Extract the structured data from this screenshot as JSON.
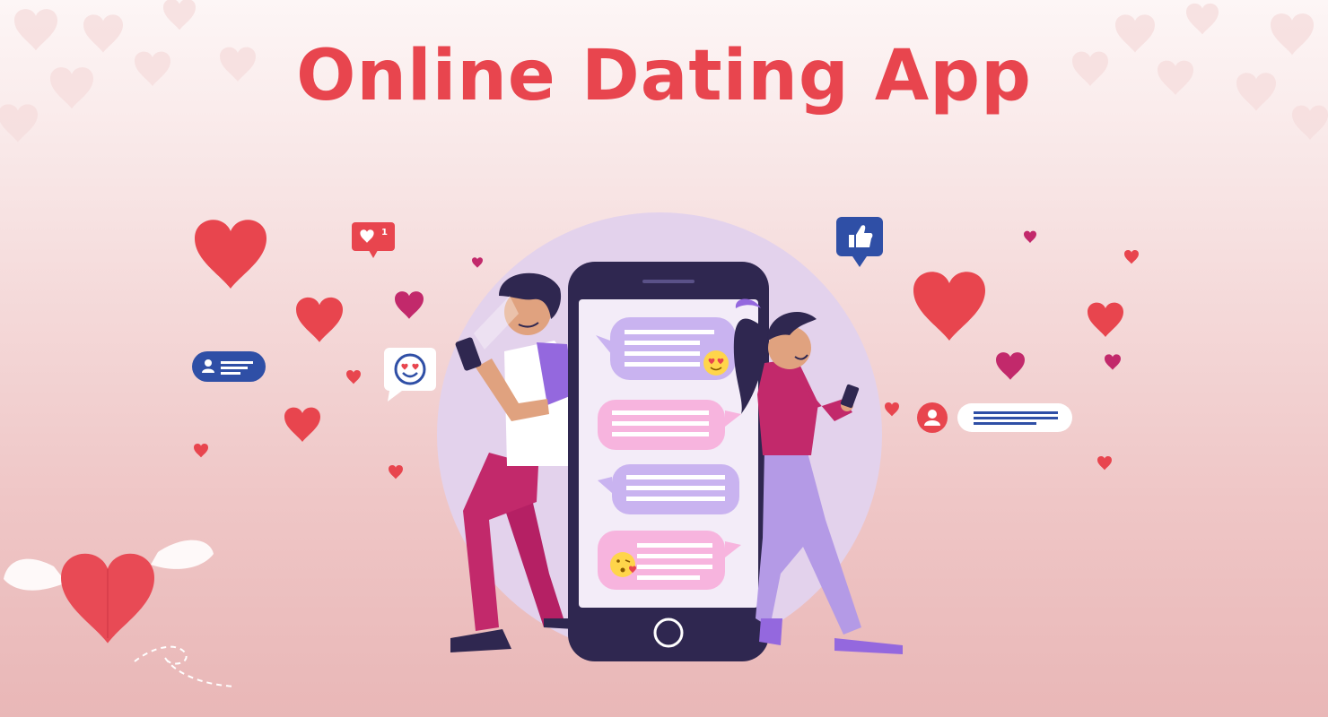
{
  "banner": {
    "title": "Online Dating App"
  },
  "colors": {
    "accent_red": "#e8454e",
    "heart_magenta": "#c2296b",
    "phone_body": "#2f2750",
    "bubble_purple": "#c9b3f0",
    "bubble_pink": "#f7b4de",
    "badge_blue": "#2f4fa6",
    "circle_lilac": "#e6d5ee"
  },
  "icons": [
    "heart-icon",
    "like-notification-icon",
    "thumbs-up-icon",
    "profile-card-icon",
    "love-eyes-emoji-icon",
    "kiss-emoji-icon",
    "user-avatar-icon",
    "winged-heart-icon"
  ],
  "notification": {
    "like_count": "1"
  }
}
